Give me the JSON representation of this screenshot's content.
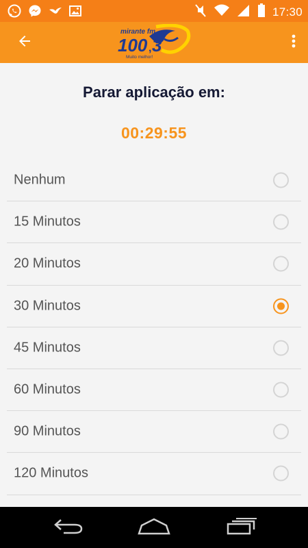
{
  "status_bar": {
    "time": "17:30",
    "left_icons": [
      "whatsapp-icon",
      "messenger-icon",
      "bird-icon",
      "image-icon"
    ],
    "right_icons": [
      "mute-icon",
      "wifi-icon",
      "signal-icon",
      "battery-icon"
    ]
  },
  "app_bar": {
    "back_icon": "arrow-left-icon",
    "menu_icon": "more-vert-icon",
    "logo": {
      "brand": "mirante fm",
      "frequency": "100,3",
      "slogan": "Muito melhor!"
    }
  },
  "sleep_timer": {
    "title": "Parar aplicação em:",
    "remaining": "00:29:55",
    "selected_index": 3,
    "options": [
      {
        "label": "Nenhum",
        "selected": false
      },
      {
        "label": "15 Minutos",
        "selected": false
      },
      {
        "label": "20 Minutos",
        "selected": false
      },
      {
        "label": "30 Minutos",
        "selected": true
      },
      {
        "label": "45 Minutos",
        "selected": false
      },
      {
        "label": "60 Minutos",
        "selected": false
      },
      {
        "label": "90 Minutos",
        "selected": false
      },
      {
        "label": "120 Minutos",
        "selected": false
      }
    ]
  },
  "nav_bar": {
    "buttons": [
      "back-nav-icon",
      "home-nav-icon",
      "recents-nav-icon"
    ]
  },
  "colors": {
    "accent": "#f7941d",
    "status_bar": "#f57f17",
    "title_text": "#151934",
    "option_text": "#555555",
    "divider": "#d9d9d9"
  }
}
